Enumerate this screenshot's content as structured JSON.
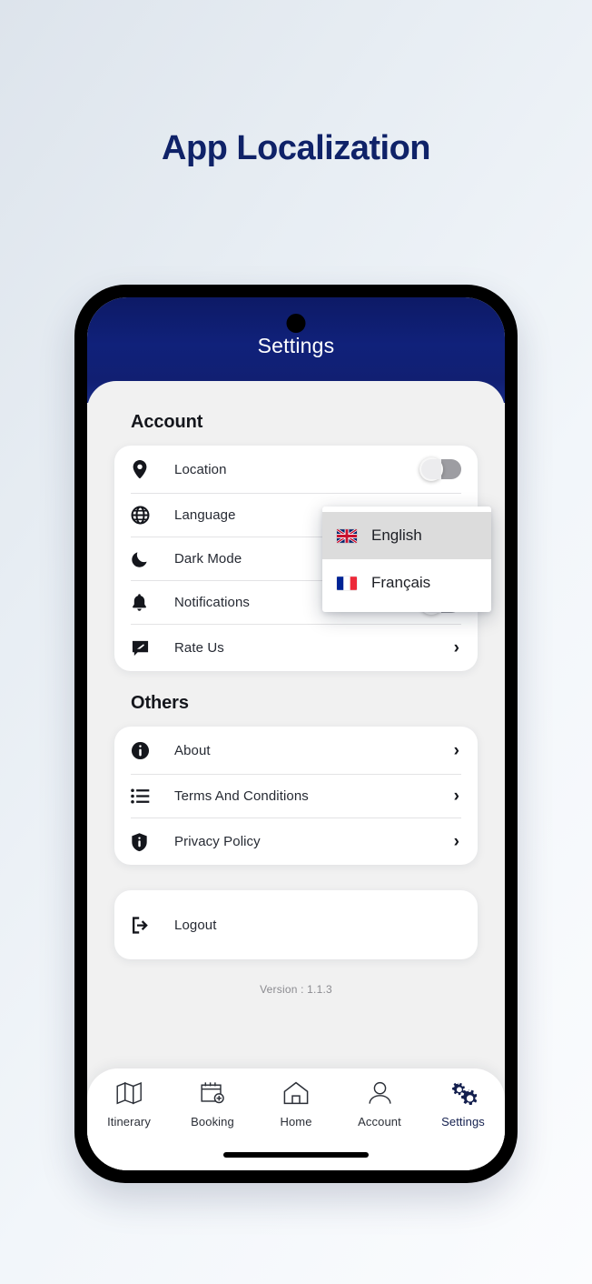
{
  "page": {
    "heading": "App Localization",
    "heading_color": "#0f2268",
    "background_accent": "#e7edf3"
  },
  "phone": {
    "header": {
      "title": "Settings",
      "bg_color": "#10217a",
      "text_color": "#ffffff"
    },
    "status_bar": {
      "left": "",
      "right": ""
    }
  },
  "sections": [
    {
      "title": "Account",
      "rows": [
        {
          "icon": "location-pin-icon",
          "label": "Location",
          "control": "toggle",
          "toggle_on": false
        },
        {
          "icon": "globe-icon",
          "label": "Language",
          "control": "dropdown",
          "toggle_on": false
        },
        {
          "icon": "moon-icon",
          "label": "Dark Mode",
          "control": "toggle",
          "toggle_on": false
        },
        {
          "icon": "bell-icon",
          "label": "Notifications",
          "control": "toggle",
          "toggle_on": false
        },
        {
          "icon": "rate-chat-icon",
          "label": "Rate Us",
          "control": "chevron",
          "chevron": "›"
        }
      ]
    },
    {
      "title": "Others",
      "rows": [
        {
          "icon": "info-circle-icon",
          "label": "About",
          "control": "chevron",
          "chevron": "›"
        },
        {
          "icon": "list-icon",
          "label": "Terms And Conditions",
          "control": "chevron",
          "chevron": "›"
        },
        {
          "icon": "shield-info-icon",
          "label": "Privacy Policy",
          "control": "chevron",
          "chevron": "›"
        }
      ]
    }
  ],
  "logout": {
    "icon": "logout-arrow-icon",
    "label": "Logout"
  },
  "version": {
    "text": "Version : 1.1.3"
  },
  "language_menu": {
    "visible": true,
    "selected": "English",
    "items": [
      {
        "label": "English",
        "flag": "uk-flag-icon",
        "selected": true
      },
      {
        "label": "Français",
        "flag": "france-flag-icon",
        "selected": false
      }
    ]
  },
  "bottom_nav": {
    "active": "Settings",
    "items": [
      {
        "icon": "map-icon",
        "label": "Itinerary",
        "active": false
      },
      {
        "icon": "calendar-add-icon",
        "label": "Booking",
        "active": false
      },
      {
        "icon": "home-icon",
        "label": "Home",
        "active": false
      },
      {
        "icon": "person-icon",
        "label": "Account",
        "active": false
      },
      {
        "icon": "gears-icon",
        "label": "Settings",
        "active": true
      }
    ]
  }
}
